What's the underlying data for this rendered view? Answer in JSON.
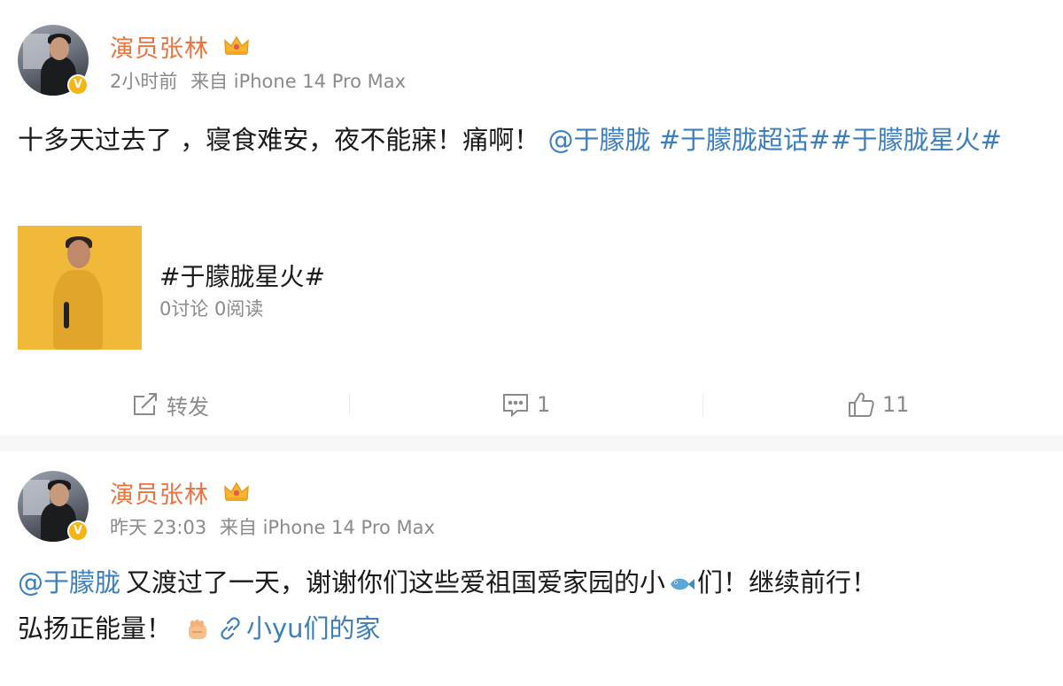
{
  "posts": [
    {
      "username": "演员张林",
      "time": "2小时前",
      "source": "来自 iPhone 14 Pro Max",
      "text_main": "十多天过去了 ，寝食难安，夜不能寐！痛啊！",
      "mention": "@于朦胧",
      "topic1": "#于朦胧超话#",
      "topic2": "#于朦胧星火#",
      "card": {
        "title": "#于朦胧星火#",
        "stats": "0讨论 0阅读"
      },
      "actions": {
        "repost_label": "转发",
        "comment_count": "1",
        "like_count": "11"
      }
    },
    {
      "username": "演员张林",
      "time": "昨天 23:03",
      "source": "来自 iPhone 14 Pro Max",
      "mention": "@于朦胧",
      "text_a": "又渡过了一天，谢谢你们这些爱祖国爱家园的小",
      "text_b": "们！继续前行！",
      "text_c": "弘扬正能量！",
      "link_text": "小yu们的家"
    }
  ],
  "icons": {
    "crown": "crown-icon",
    "verified": "verified-v-icon",
    "repost": "repost-icon",
    "comment": "comment-icon",
    "like": "thumbs-up-icon",
    "fish_emoji": "fish-emoji-icon",
    "fist_emoji": "fist-emoji-icon",
    "link": "link-icon"
  },
  "colors": {
    "username": "#eb7340",
    "link": "#3d7ebd",
    "meta": "#8a8a8a",
    "verified_badge": "#f5b515"
  }
}
